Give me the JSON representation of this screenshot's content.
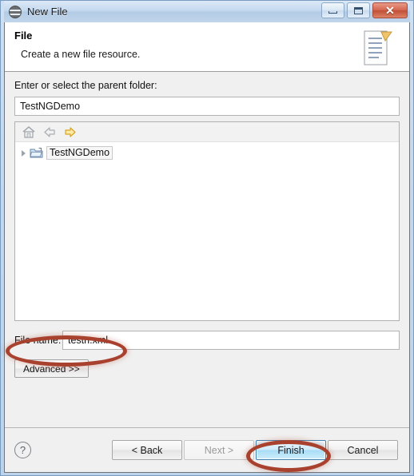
{
  "window": {
    "title": "New File",
    "title_icon": "eclipse-circle-icon",
    "controls": [
      {
        "name": "minimize",
        "glyph": "minimize-icon"
      },
      {
        "name": "maximize",
        "glyph": "maximize-icon"
      },
      {
        "name": "close",
        "glyph": "close-icon",
        "symbol": "✕"
      }
    ]
  },
  "header": {
    "title": "File",
    "description": "Create a new file resource.",
    "icon": "new-file-page-icon"
  },
  "form": {
    "parent_folder_label": "Enter or select the parent folder:",
    "parent_folder_value": "TestNGDemo",
    "filename_label": "File name:",
    "filename_value": "testn.xml",
    "advanced_label": "Advanced >>"
  },
  "tree": {
    "toolbar": [
      {
        "name": "home-icon"
      },
      {
        "name": "back-arrow-icon"
      },
      {
        "name": "forward-arrow-icon"
      }
    ],
    "items": [
      {
        "label": "TestNGDemo",
        "icon": "project-folder-icon",
        "expanded": false
      }
    ]
  },
  "buttons": {
    "help": "?",
    "back": "< Back",
    "next": "Next >",
    "finish": "Finish",
    "cancel": "Cancel"
  },
  "colors": {
    "titlebar_start": "#dce9f7",
    "titlebar_end": "#c0d5ea",
    "dialog_bg": "#f0f0f0",
    "default_button_border": "#3c7fb1",
    "default_button_fill": "#a8dcf7",
    "annotation": "#a8422f",
    "close_button": "#c04f36"
  }
}
